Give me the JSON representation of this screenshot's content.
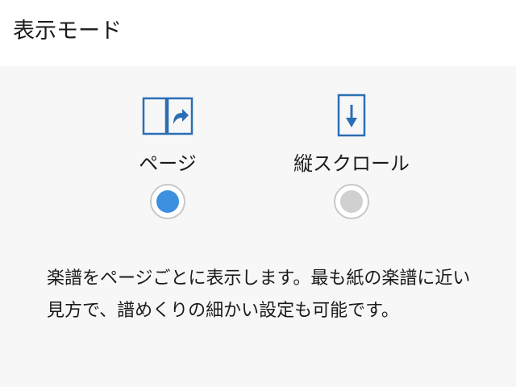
{
  "header": {
    "title": "表示モード"
  },
  "options": [
    {
      "label": "ページ",
      "icon": "book-page-turn-icon",
      "selected": true
    },
    {
      "label": "縦スクロール",
      "icon": "vertical-scroll-icon",
      "selected": false
    }
  ],
  "description": "楽譜をページごとに表示します。最も紙の楽譜に近い見方で、譜めくりの細かい設定も可能です。",
  "colors": {
    "accent": "#3d8fe0",
    "icon": "#2a6fb5",
    "panel_background": "#f7f7f7",
    "radio_unselected": "#d0d0d0"
  }
}
